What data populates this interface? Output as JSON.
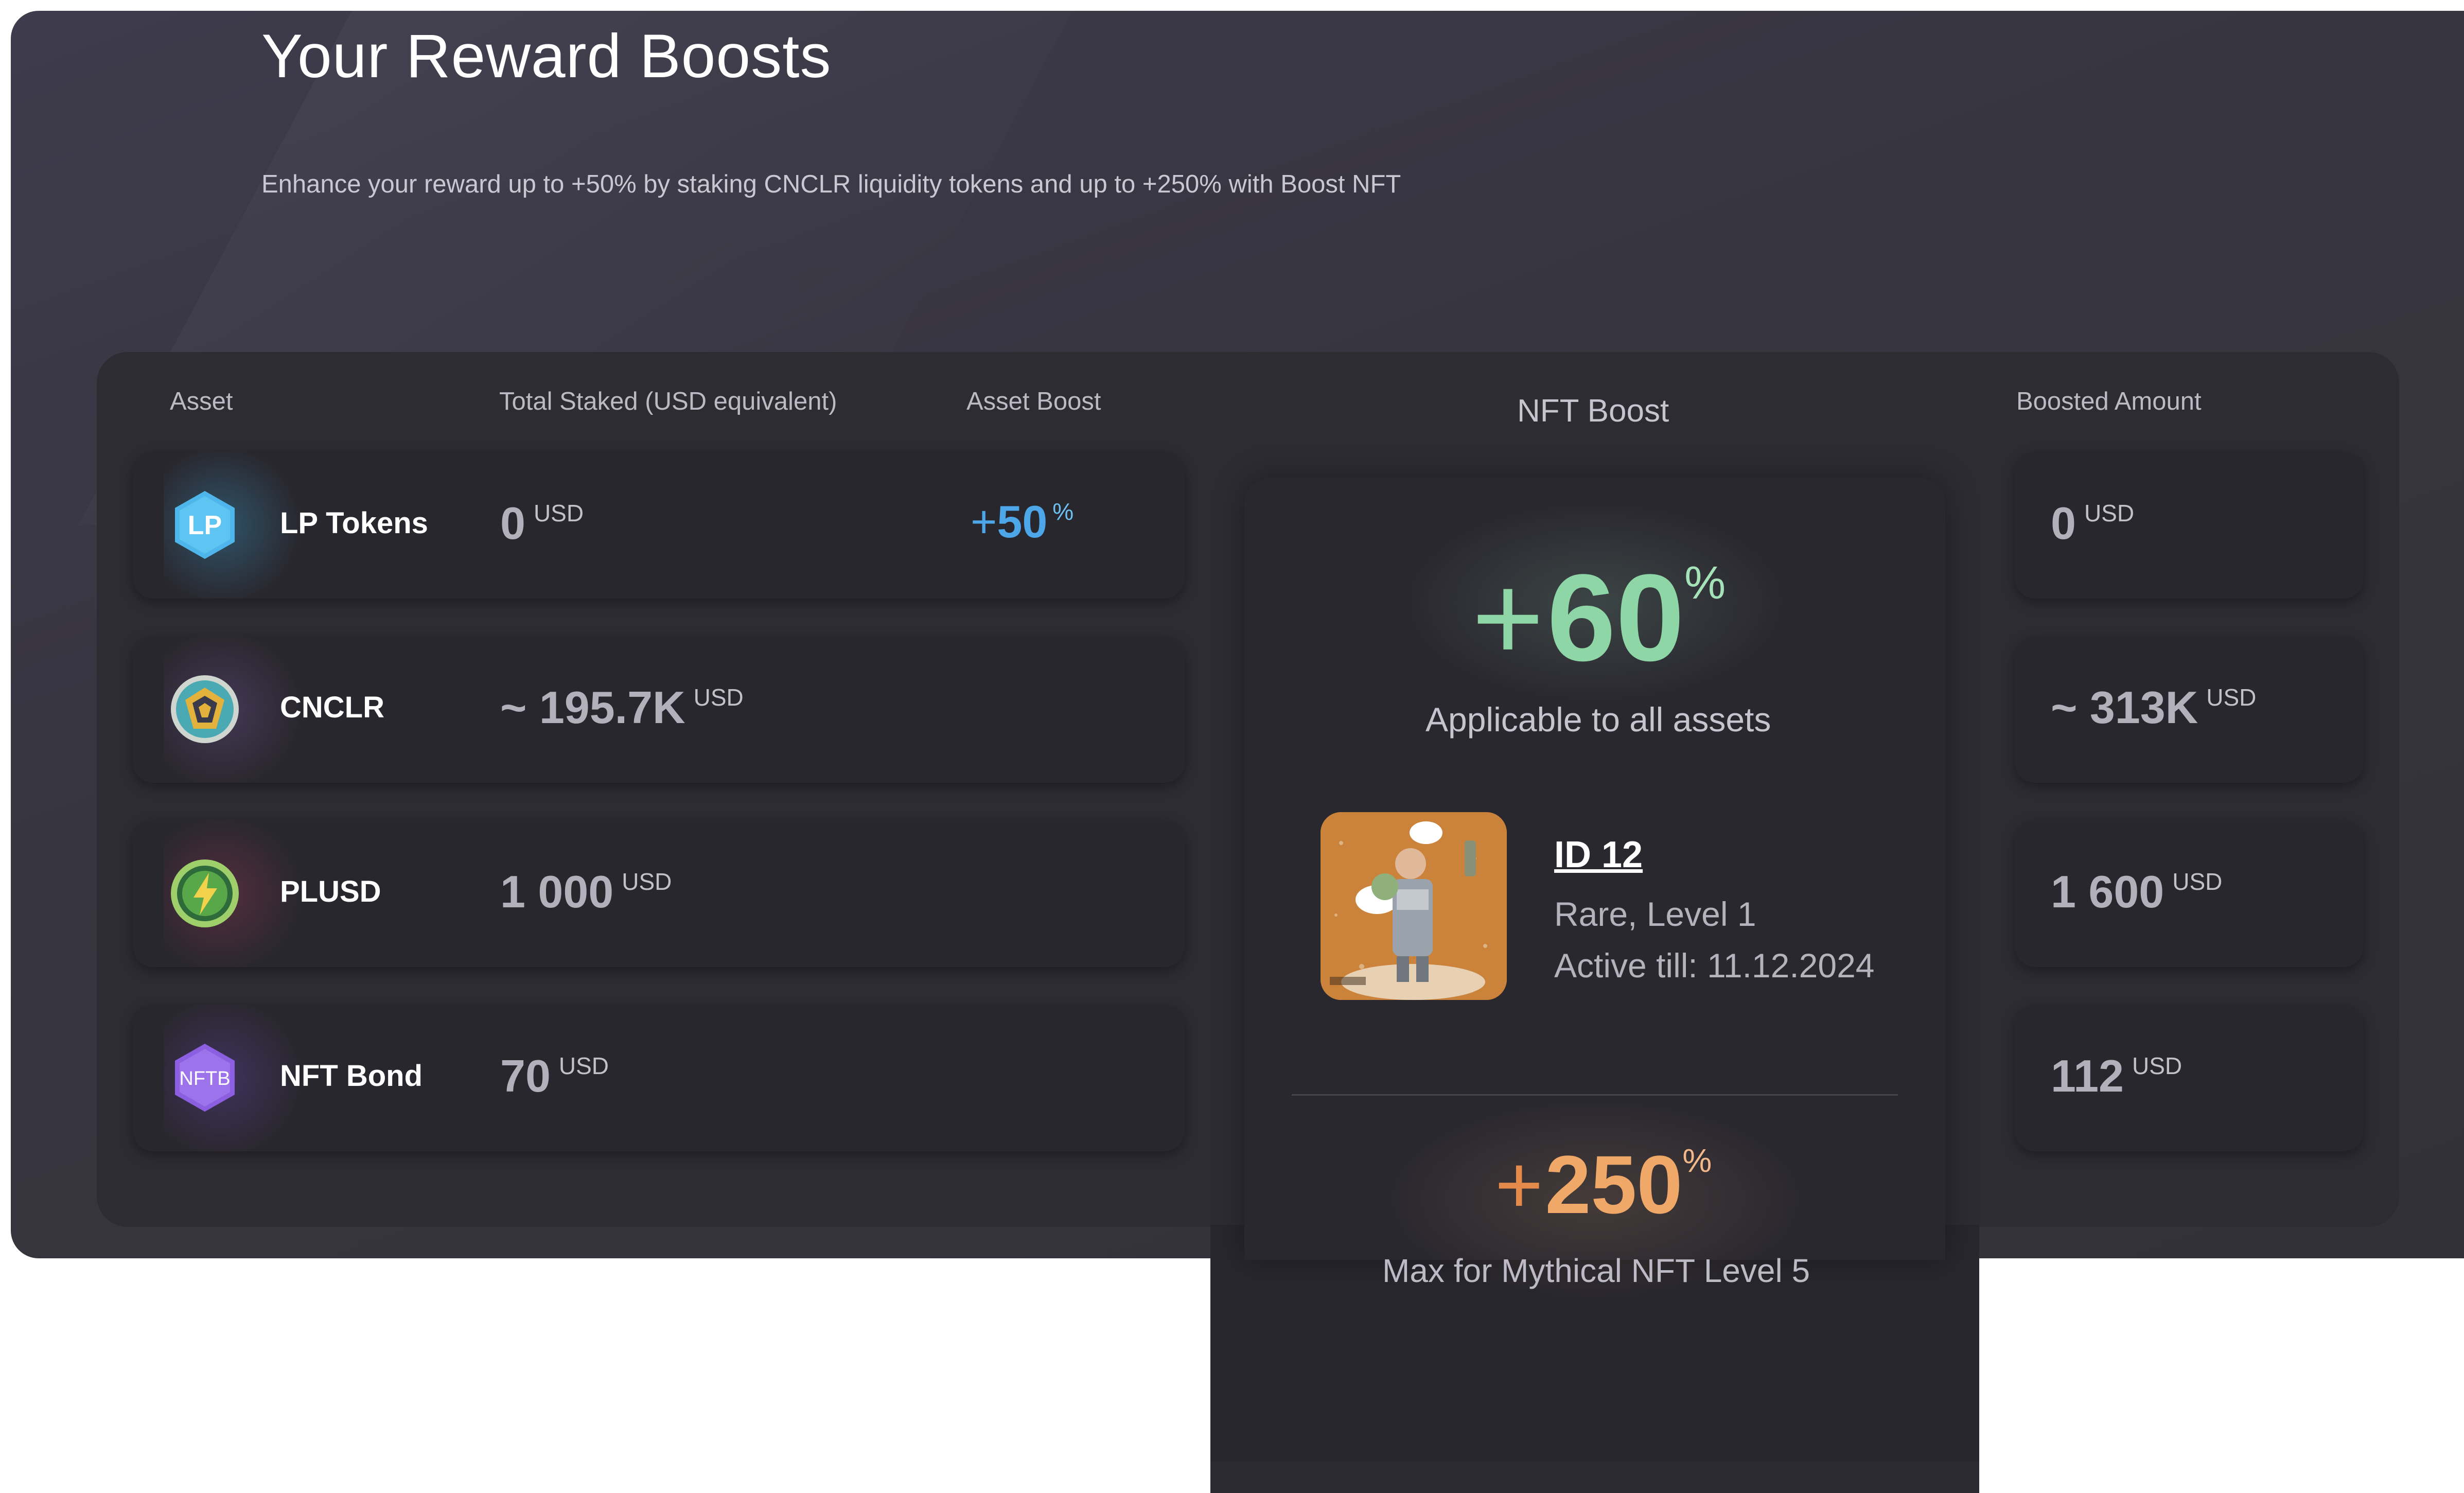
{
  "header": {
    "title": "Your Reward Boosts",
    "subtitle": "Enhance your reward up to +50% by staking CNCLR liquidity tokens and up to +250% with Boost NFT"
  },
  "table": {
    "columns": {
      "asset": "Asset",
      "total_staked": "Total Staked (USD equivalent)",
      "asset_boost": "Asset Boost",
      "nft_boost": "NFT Boost",
      "boosted_amount": "Boosted Amount"
    },
    "rows": [
      {
        "icon": "lp-token-icon",
        "icon_text": "LP",
        "asset": "LP Tokens",
        "staked": "0",
        "staked_unit": "USD",
        "boost_plus": "+",
        "boost": "50",
        "boost_pct": "%",
        "boosted": "0",
        "boosted_unit": "USD"
      },
      {
        "icon": "cnclr-icon",
        "asset": "CNCLR",
        "staked": "~ 195.7K",
        "staked_unit": "USD",
        "boosted": "~ 313K",
        "boosted_unit": "USD"
      },
      {
        "icon": "plusd-icon",
        "asset": "PLUSD",
        "staked": "1 000",
        "staked_unit": "USD",
        "boosted": "1 600",
        "boosted_unit": "USD"
      },
      {
        "icon": "nft-bond-icon",
        "icon_text": "NFTB",
        "asset": "NFT Bond",
        "staked": "70",
        "staked_unit": "USD",
        "boosted": "112",
        "boosted_unit": "USD"
      }
    ]
  },
  "nft": {
    "boost_plus": "+",
    "boost_value": "60",
    "boost_pct": "%",
    "applicable": "Applicable to all assets",
    "id": "ID 12",
    "rarity": "Rare, Level 1",
    "active": "Active till: 11.12.2024",
    "max_plus": "+",
    "max_value": "250",
    "max_pct": "%",
    "max_label": "Max for Mythical NFT Level 5"
  },
  "colors": {
    "asset_boost": "#4ca6e8",
    "nft_boost": "#8fd6a7",
    "max_boost": "#f0a868",
    "panel": "#37353f",
    "card": "#2e2c33"
  }
}
